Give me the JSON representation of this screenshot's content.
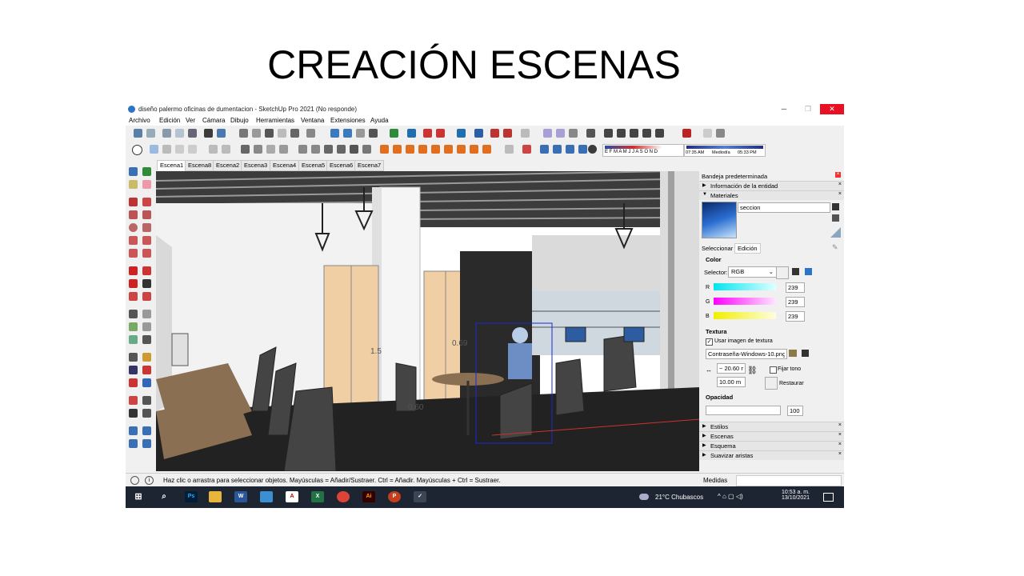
{
  "slide": {
    "title": "CREACIÓN ESCENAS"
  },
  "window": {
    "title": "diseño palermo oficinas de dumentacion - SketchUp Pro 2021 (No responde)",
    "minimize": "─",
    "maximize": "❐",
    "close": "✕"
  },
  "menu": [
    "Archivo",
    "Edición",
    "Ver",
    "Cámara",
    "Dibujo",
    "Herramientas",
    "Ventana",
    "Extensiones",
    "Ayuda"
  ],
  "scenes": {
    "tabs": [
      "Escena1",
      "Escena8",
      "Escena2",
      "Escena3",
      "Escena4",
      "Escena5",
      "Escena6",
      "Escena7"
    ],
    "active": "Escena1"
  },
  "shadow": {
    "months": "E F M A M J J A S O N D",
    "time_start": "07:35 AM",
    "time_mid": "Mediodía",
    "time_end": "05:33 PM"
  },
  "viewport": {
    "dims": [
      "1.5",
      "0.69",
      "0.60"
    ]
  },
  "tray": {
    "header": "Bandeja predeterminada",
    "entity_info": "Información de la entidad",
    "materials": "Materiales",
    "material_name": "seccion",
    "tab_select": "Seleccionar",
    "tab_edit": "Edición",
    "color_heading": "Color",
    "selector_label": "Selector:",
    "selector_value": "RGB",
    "r_label": "R",
    "g_label": "G",
    "b_label": "B",
    "r_value": "239",
    "g_value": "239",
    "b_value": "239",
    "texture_heading": "Textura",
    "use_texture": "Usar imagen de textura",
    "texture_file": "Contraseña-Windows-10.png",
    "width_value": "~ 20.60 r",
    "height_value": "10.00 m",
    "fix_tone": "Fijar tono",
    "restore": "Restaurar",
    "opacity_heading": "Opacidad",
    "opacity_value": "100",
    "styles": "Estilos",
    "scenes": "Escenas",
    "outline": "Esquema",
    "soften": "Suavizar aristas"
  },
  "status": {
    "hint": "Haz clic o arrastra para seleccionar objetos. Mayúsculas = Añadir/Sustraer. Ctrl = Añadir. Mayúsculas + Ctrl = Sustraer.",
    "measures": "Medidas"
  },
  "taskbar": {
    "weather": "21°C  Chubascos",
    "time": "10:53 a. m.",
    "date": "13/10/2021"
  },
  "colors": {
    "accent": "#2c74c5",
    "close_red": "#e81123",
    "taskbar": "#1d2532",
    "r_bar": "#00e5f0",
    "g_bar": "#ff00ff",
    "b_bar": "#f0f000"
  }
}
